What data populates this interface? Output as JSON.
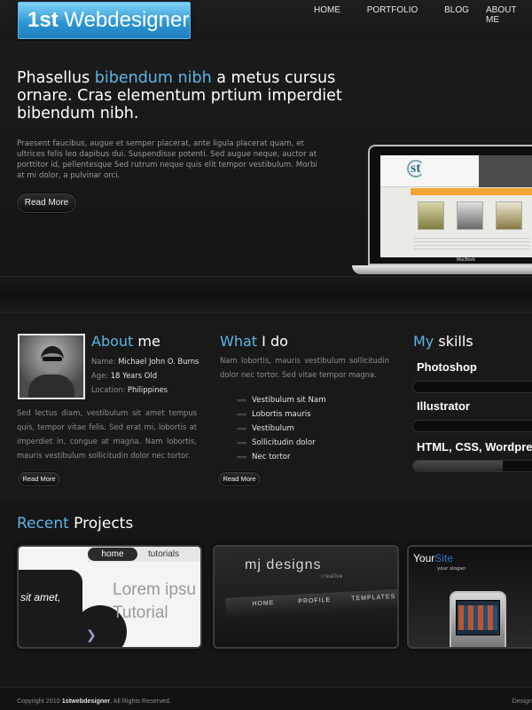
{
  "header": {
    "logo_bold": "1st",
    "logo_rest": "Webdesigner",
    "nav": [
      "HOME",
      "PORTFOLIO",
      "BLOG",
      "ABOUT ME"
    ]
  },
  "hero": {
    "heading_pre": "Phasellus",
    "heading_accent": "bibendum nibh",
    "heading_post": "a metus cursus ornare. Cras elementum prtium imperdiet bibendum nibh.",
    "paragraph": "Praesent faucibus, augue et semper placerat, ante ligula placerat quam, et ultrices felis leo dapibus dui. Suspendisse potenti. Sed augue neque, auctor at porttitor id, pellentesque Sed rutrum neque quis elit tempor vestibulum. Morbi at mi dolor, a pulvinar orci.",
    "button": "Read More",
    "laptop_label": "MacBook"
  },
  "about": {
    "title_accent": "About",
    "title_rest": "me",
    "name_label": "Name:",
    "name_value": "Michael John O. Burns",
    "age_label": "Age:",
    "age_value": "18 Years Old",
    "location_label": "Location:",
    "location_value": "Philippines",
    "paragraph": "Sed lectus diam, vestibulum sit amet tempus quis, tempor vitae felis. Sed erat mi, lobortis at imperdiet in, congue at magna. Nam lobortis, mauris vestibulum sollicitudin dolor nec tortor.",
    "button": "Read More"
  },
  "whatido": {
    "title_accent": "What",
    "title_rest": "I do",
    "paragraph": "Nam lobortis, mauris vestibulum sollicitudin dolor nec tortor. Sed vitae tempor magna.",
    "items": [
      "Vestibulum sit Nam",
      "Lobortis mauris",
      "Vestibulum",
      "Sollicitudin dolor",
      "Nec tortor"
    ],
    "button": "Read More"
  },
  "skills": {
    "title_accent": "My",
    "title_rest": "skills",
    "items": [
      {
        "name": "Photoshop",
        "level": 0.0
      },
      {
        "name": "Illustrator",
        "level": 0.0
      },
      {
        "name": "HTML, CSS, Wordpre",
        "level": 0.75
      }
    ]
  },
  "projects": {
    "title_accent": "Recent",
    "title_rest": "Projects",
    "p1": {
      "tab_home": "home",
      "tab_tutorials": "tutorials",
      "side_text": "sit amet,",
      "lorem": "Lorem ipsu",
      "tutorial": "Tutorial"
    },
    "p2": {
      "brand": "mj designs",
      "creative": "creative",
      "nav": [
        "HOME",
        "PROFILE",
        "TEMPLATES"
      ]
    },
    "p3": {
      "your": "Your",
      "site": "Site",
      "slogan": "your slogan"
    }
  },
  "footer": {
    "copy_pre": "Copyright 2010",
    "copy_brand": "1stwebdesigner",
    "copy_post": ", All Rights Reserved.",
    "design": "Design"
  },
  "colors": {
    "accent": "#5cb6e6",
    "background": "#161616",
    "logo": "#2a93d1"
  }
}
